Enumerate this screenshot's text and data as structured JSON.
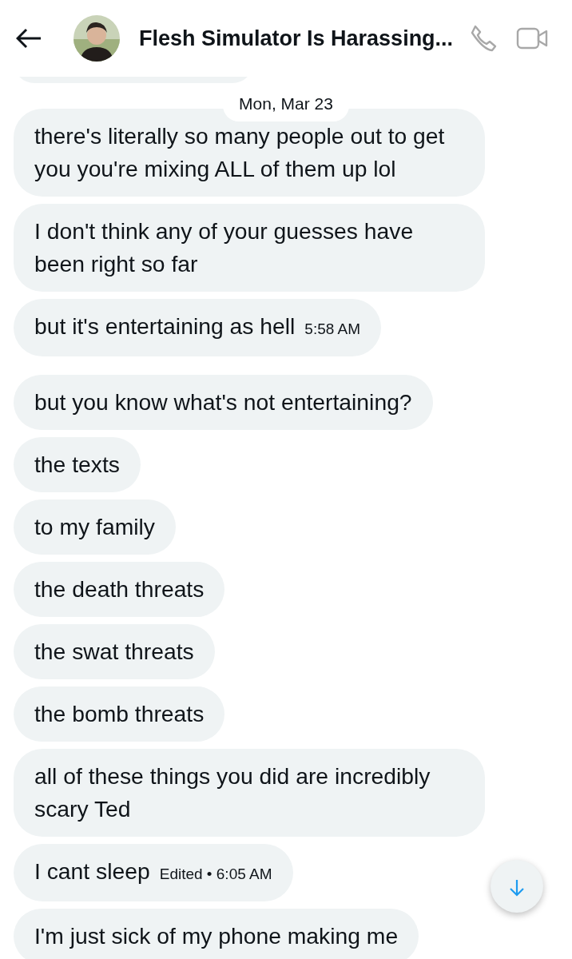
{
  "header": {
    "title": "Flesh Simulator Is Harassing..."
  },
  "date_separator": "Mon, Mar 23",
  "messages": [
    {
      "text": "there's literally so many people out to get you you're mixing ALL of them up lol",
      "gap_before": false
    },
    {
      "text": "I don't think any of your guesses have been right so far",
      "gap_before": false
    },
    {
      "text": "but it's entertaining as hell",
      "meta": "5:58 AM",
      "gap_before": false
    },
    {
      "text": "but you know what's not entertaining?",
      "gap_before": true
    },
    {
      "text": "the texts",
      "gap_before": false
    },
    {
      "text": "to my family",
      "gap_before": false
    },
    {
      "text": "the death threats",
      "gap_before": false
    },
    {
      "text": "the swat threats",
      "gap_before": false
    },
    {
      "text": "the bomb threats",
      "gap_before": false
    },
    {
      "text": "all of these things you did are incredibly scary Ted",
      "gap_before": false
    },
    {
      "text": "I cant sleep",
      "meta": "Edited • 6:05 AM",
      "gap_before": false
    },
    {
      "text": "I'm just sick of my phone making me",
      "gap_before": false
    }
  ]
}
